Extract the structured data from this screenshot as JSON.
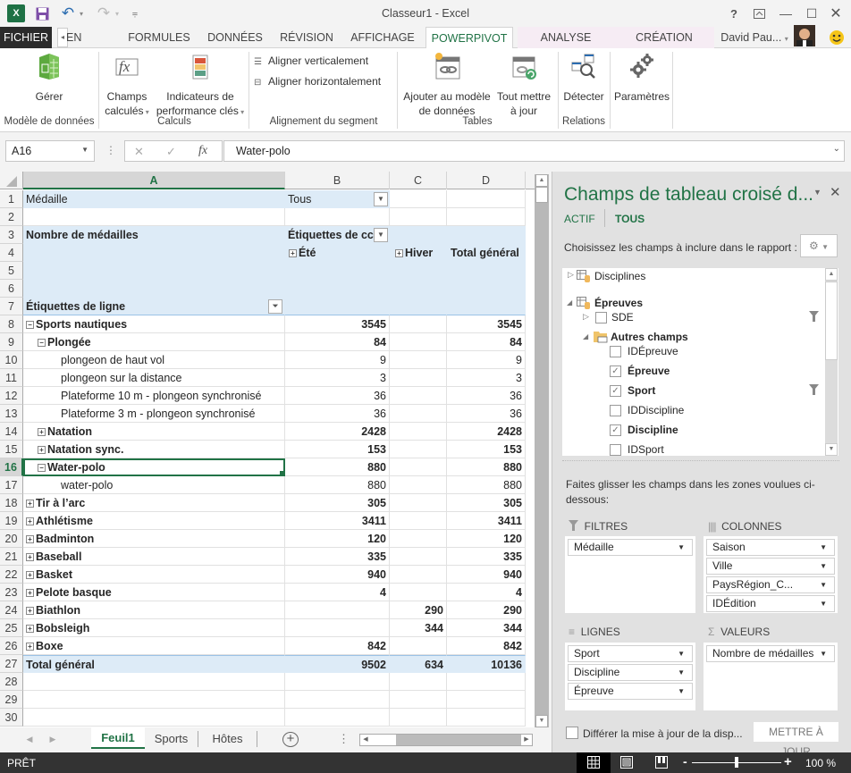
{
  "window": {
    "title": "Classeur1 - Excel",
    "user_name": "David Pau...",
    "controls": {
      "help": "?",
      "restore_ribbon": "⊼",
      "minimize": "—",
      "maximize": "☐",
      "close": "✕"
    }
  },
  "qat": {
    "excel_icon": "X",
    "save_icon": "save-icon",
    "undo_icon": "↶",
    "redo_icon": "↷",
    "customize": "⩦"
  },
  "tabs": {
    "file": "FICHIER",
    "page_layout": "EN PAGE",
    "formulas": "FORMULES",
    "data": "DONNÉES",
    "review": "RÉVISION",
    "view": "AFFICHAGE",
    "powerpivot": "POWERPIVOT",
    "analyze": "ANALYSE",
    "design": "CRÉATION"
  },
  "ribbon": {
    "manage": "Gérer",
    "group_data_model": "Modèle de données",
    "calc_fields_1": "Champs",
    "calc_fields_2": "calculés",
    "kpi_1": "Indicateurs de",
    "kpi_2": "performance clés",
    "group_calculations": "Calculs",
    "align_vertical": "Aligner verticalement",
    "align_horizontal": "Aligner horizontalement",
    "group_slicer_alignment": "Alignement du segment",
    "add_model_1": "Ajouter au modèle",
    "add_model_2": "de données",
    "update_all_1": "Tout mettre",
    "update_all_2": "à jour",
    "group_tables": "Tables",
    "detect": "Détecter",
    "group_relations": "Relations",
    "settings": "Paramètres"
  },
  "formula_bar": {
    "name_box": "A16",
    "cancel": "✕",
    "enter": "✓",
    "fx": "fx",
    "formula": "Water-polo"
  },
  "columns": [
    "A",
    "B",
    "C",
    "D"
  ],
  "pivot": {
    "filter_label": "Médaille",
    "filter_value": "Tous",
    "value_header": "Nombre de médailles",
    "col_labels": "Étiquettes de cc",
    "col_summer": "Été",
    "col_winter": "Hiver",
    "col_total": "Total général",
    "row_labels": "Étiquettes de ligne",
    "rows": [
      {
        "n": "8",
        "label": "Sports nautiques",
        "level": 0,
        "toggle": "−",
        "bold": true,
        "b": "3545",
        "c": "",
        "d": "3545"
      },
      {
        "n": "9",
        "label": "Plongée",
        "level": 1,
        "toggle": "−",
        "bold": true,
        "b": "84",
        "c": "",
        "d": "84"
      },
      {
        "n": "10",
        "label": "plongeon de haut vol",
        "level": 2,
        "toggle": "",
        "bold": false,
        "b": "9",
        "c": "",
        "d": "9"
      },
      {
        "n": "11",
        "label": "plongeon sur la distance",
        "level": 2,
        "toggle": "",
        "bold": false,
        "b": "3",
        "c": "",
        "d": "3"
      },
      {
        "n": "12",
        "label": "Plateforme 10 m - plongeon synchronisé",
        "level": 2,
        "toggle": "",
        "bold": false,
        "b": "36",
        "c": "",
        "d": "36"
      },
      {
        "n": "13",
        "label": "Plateforme 3 m - plongeon synchronisé",
        "level": 2,
        "toggle": "",
        "bold": false,
        "b": "36",
        "c": "",
        "d": "36"
      },
      {
        "n": "14",
        "label": "Natation",
        "level": 1,
        "toggle": "+",
        "bold": true,
        "b": "2428",
        "c": "",
        "d": "2428"
      },
      {
        "n": "15",
        "label": "Natation sync.",
        "level": 1,
        "toggle": "+",
        "bold": true,
        "b": "153",
        "c": "",
        "d": "153"
      },
      {
        "n": "16",
        "label": "Water-polo",
        "level": 1,
        "toggle": "−",
        "bold": true,
        "b": "880",
        "c": "",
        "d": "880",
        "selected": true
      },
      {
        "n": "17",
        "label": "water-polo",
        "level": 2,
        "toggle": "",
        "bold": false,
        "b": "880",
        "c": "",
        "d": "880"
      },
      {
        "n": "18",
        "label": "Tir à l’arc",
        "level": 0,
        "toggle": "+",
        "bold": true,
        "b": "305",
        "c": "",
        "d": "305"
      },
      {
        "n": "19",
        "label": "Athlétisme",
        "level": 0,
        "toggle": "+",
        "bold": true,
        "b": "3411",
        "c": "",
        "d": "3411"
      },
      {
        "n": "20",
        "label": "Badminton",
        "level": 0,
        "toggle": "+",
        "bold": true,
        "b": "120",
        "c": "",
        "d": "120"
      },
      {
        "n": "21",
        "label": "Baseball",
        "level": 0,
        "toggle": "+",
        "bold": true,
        "b": "335",
        "c": "",
        "d": "335"
      },
      {
        "n": "22",
        "label": "Basket",
        "level": 0,
        "toggle": "+",
        "bold": true,
        "b": "940",
        "c": "",
        "d": "940"
      },
      {
        "n": "23",
        "label": "Pelote basque",
        "level": 0,
        "toggle": "+",
        "bold": true,
        "b": "4",
        "c": "",
        "d": "4"
      },
      {
        "n": "24",
        "label": "Biathlon",
        "level": 0,
        "toggle": "+",
        "bold": true,
        "b": "",
        "c": "290",
        "d": "290"
      },
      {
        "n": "25",
        "label": "Bobsleigh",
        "level": 0,
        "toggle": "+",
        "bold": true,
        "b": "",
        "c": "344",
        "d": "344"
      },
      {
        "n": "26",
        "label": "Boxe",
        "level": 0,
        "toggle": "+",
        "bold": true,
        "b": "842",
        "c": "",
        "d": "842"
      }
    ],
    "grand_total": {
      "n": "27",
      "label": "Total général",
      "b": "9502",
      "c": "634",
      "d": "10136"
    }
  },
  "row_numbers_header": [
    "1",
    "2",
    "3",
    "4",
    "5",
    "6",
    "7"
  ],
  "row_numbers_tail": [
    "28",
    "29",
    "30"
  ],
  "sheets": {
    "tabs": [
      "Feuil1",
      "Sports",
      "Hôtes"
    ],
    "active": "Feuil1",
    "add": "+"
  },
  "status": {
    "ready": "PRÊT",
    "zoom_level": "100 %",
    "zoom_minus": "-",
    "zoom_plus": "+"
  },
  "pane": {
    "title": "Champs de tableau croisé d...",
    "tab_active": "ACTIF",
    "tab_all": "TOUS",
    "choose_label": "Choisissez les champs à inclure dans le rapport :",
    "fields": {
      "disciplines": "Disciplines",
      "epreuves": "Épreuves",
      "sde": "SDE",
      "other_fields": "Autres champs",
      "items": [
        {
          "label": "IDÉpreuve",
          "checked": false,
          "bold": false
        },
        {
          "label": "Épreuve",
          "checked": true,
          "bold": true
        },
        {
          "label": "Sport",
          "checked": true,
          "bold": true,
          "filtered": true
        },
        {
          "label": "IDDiscipline",
          "checked": false,
          "bold": false
        },
        {
          "label": "Discipline",
          "checked": true,
          "bold": true
        },
        {
          "label": "IDSport",
          "checked": false,
          "bold": false
        }
      ]
    },
    "drag_hint": "Faites glisser les champs dans les zones voulues ci-dessous:",
    "zones": {
      "filters_label": "FILTRES",
      "filters": [
        "Médaille"
      ],
      "columns_label": "COLONNES",
      "columns": [
        "Saison",
        "Ville",
        "PaysRégion_C...",
        "IDÉdition"
      ],
      "rows_label": "LIGNES",
      "rows": [
        "Sport",
        "Discipline",
        "Épreuve"
      ],
      "values_label": "VALEURS",
      "values": [
        "Nombre de médailles"
      ]
    },
    "defer_label": "Différer la mise à jour de la disp...",
    "update_button": "METTRE À JOUR"
  }
}
